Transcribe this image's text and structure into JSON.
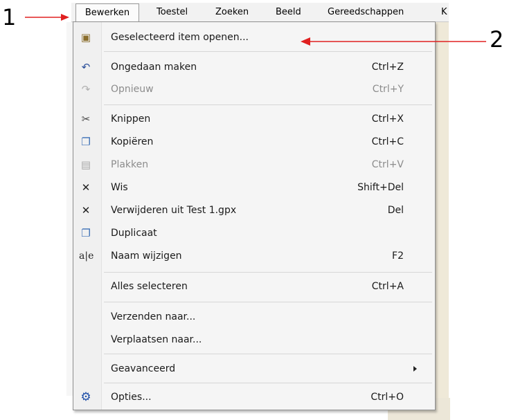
{
  "callouts": {
    "left_number": "1",
    "right_number": "2"
  },
  "menubar": {
    "items": [
      {
        "label": "Bewerken"
      },
      {
        "label": "Toestel"
      },
      {
        "label": "Zoeken"
      },
      {
        "label": "Beeld"
      },
      {
        "label": "Gereedschappen"
      },
      {
        "label": "K"
      }
    ]
  },
  "menu": {
    "items": [
      {
        "label": "Geselecteerd item openen...",
        "shortcut": ""
      },
      {
        "label": "Ongedaan maken",
        "shortcut": "Ctrl+Z"
      },
      {
        "label": "Opnieuw",
        "shortcut": "Ctrl+Y"
      },
      {
        "label": "Knippen",
        "shortcut": "Ctrl+X"
      },
      {
        "label": "Kopiëren",
        "shortcut": "Ctrl+C"
      },
      {
        "label": "Plakken",
        "shortcut": "Ctrl+V"
      },
      {
        "label": "Wis",
        "shortcut": "Shift+Del"
      },
      {
        "label": "Verwijderen uit Test 1.gpx",
        "shortcut": "Del"
      },
      {
        "label": "Duplicaat",
        "shortcut": ""
      },
      {
        "label": "Naam wijzigen",
        "shortcut": "F2"
      },
      {
        "label": "Alles selecteren",
        "shortcut": "Ctrl+A"
      },
      {
        "label": "Verzenden naar...",
        "shortcut": ""
      },
      {
        "label": "Verplaatsen naar...",
        "shortcut": ""
      },
      {
        "label": "Geavanceerd",
        "shortcut": ""
      },
      {
        "label": "Opties...",
        "shortcut": "Ctrl+O"
      }
    ]
  },
  "colors": {
    "callout_arrow": "#e02020",
    "menu_bg": "#f5f5f5",
    "disabled_text": "#8c8c8c"
  }
}
